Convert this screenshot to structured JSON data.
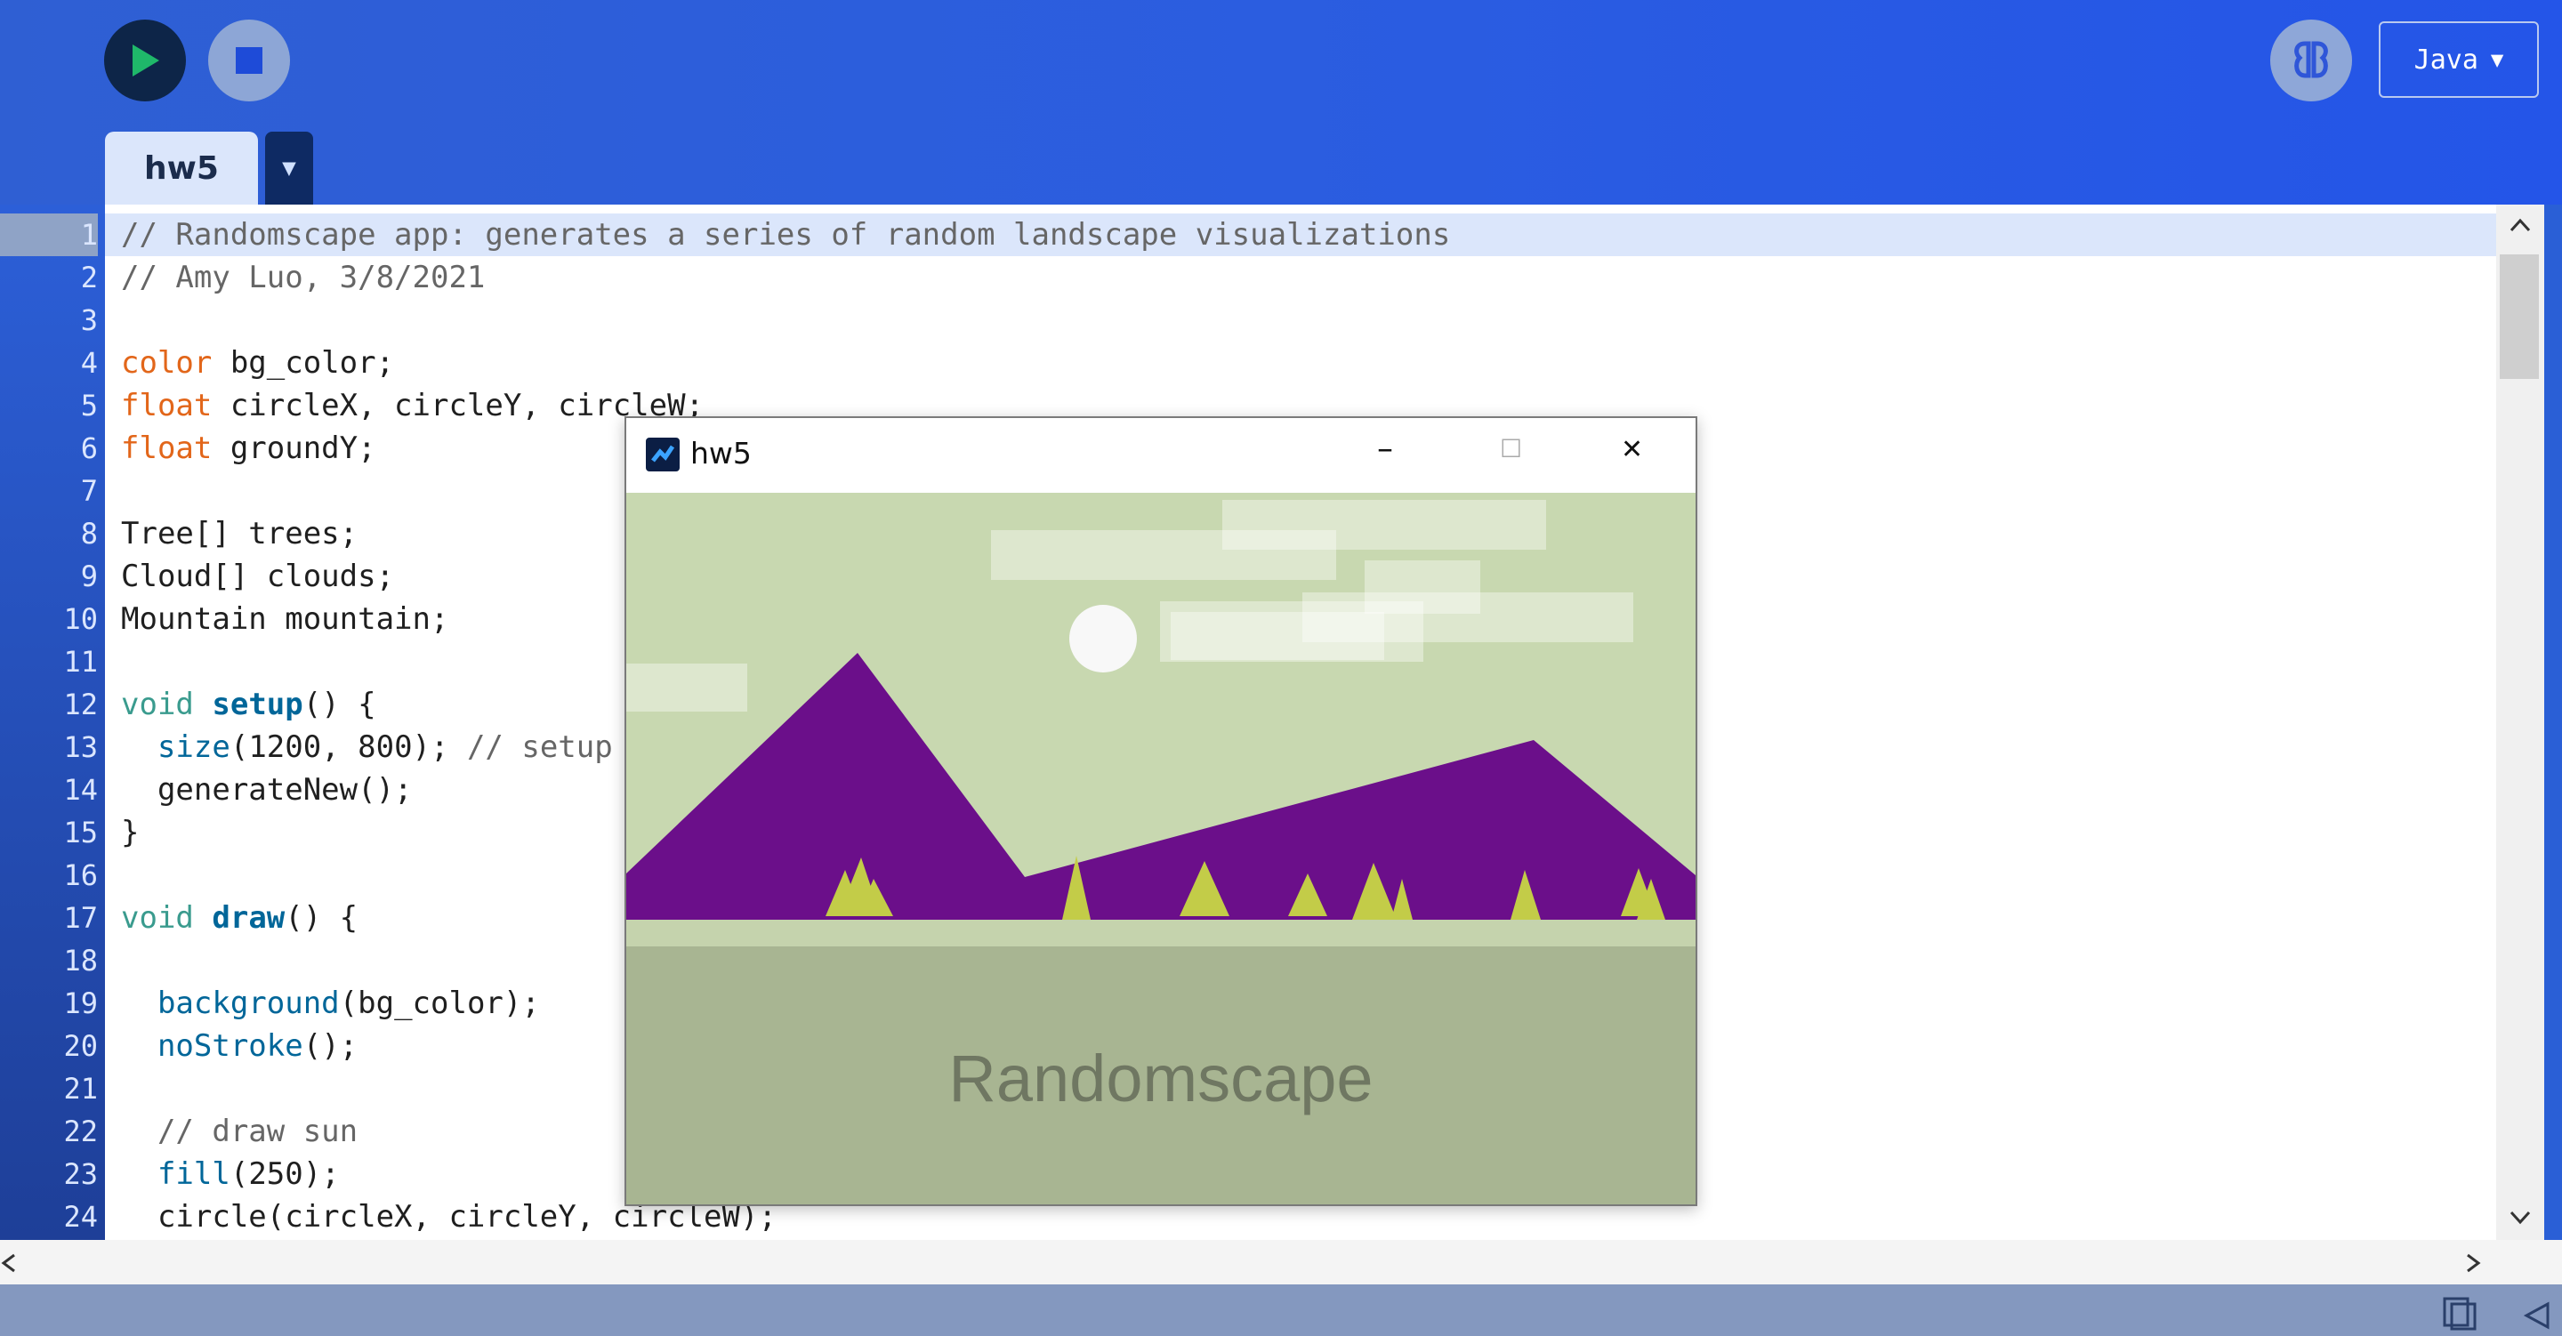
{
  "toolbar": {
    "run_label": "Run",
    "stop_label": "Stop",
    "mode": "Java",
    "mode_arrow": "▼"
  },
  "tabs": [
    {
      "label": "hw5"
    }
  ],
  "tab_menu_arrow": "▼",
  "editor": {
    "active_line": 1,
    "lines": [
      {
        "n": "1",
        "segs": [
          {
            "t": "// Randomscape app: generates a series of random landscape visualizations",
            "c": "comment"
          }
        ]
      },
      {
        "n": "2",
        "segs": [
          {
            "t": "// Amy Luo, 3/8/2021",
            "c": "comment"
          }
        ]
      },
      {
        "n": "3",
        "segs": []
      },
      {
        "n": "4",
        "segs": [
          {
            "t": "color",
            "c": "kw-type"
          },
          {
            "t": " bg_color;",
            "c": ""
          }
        ]
      },
      {
        "n": "5",
        "segs": [
          {
            "t": "float",
            "c": "kw-type"
          },
          {
            "t": " circleX, circleY, circleW;",
            "c": ""
          }
        ]
      },
      {
        "n": "6",
        "segs": [
          {
            "t": "float",
            "c": "kw-type"
          },
          {
            "t": " groundY;",
            "c": ""
          }
        ]
      },
      {
        "n": "7",
        "segs": []
      },
      {
        "n": "8",
        "segs": [
          {
            "t": "Tree[] trees;",
            "c": ""
          }
        ]
      },
      {
        "n": "9",
        "segs": [
          {
            "t": "Cloud[] clouds;",
            "c": ""
          }
        ]
      },
      {
        "n": "10",
        "segs": [
          {
            "t": "Mountain mountain;",
            "c": ""
          }
        ]
      },
      {
        "n": "11",
        "segs": []
      },
      {
        "n": "12",
        "segs": [
          {
            "t": "void",
            "c": "kw-ctrl"
          },
          {
            "t": " ",
            "c": ""
          },
          {
            "t": "setup",
            "c": "fn-def"
          },
          {
            "t": "() {",
            "c": ""
          }
        ]
      },
      {
        "n": "13",
        "segs": [
          {
            "t": "  ",
            "c": ""
          },
          {
            "t": "size",
            "c": "fn-call"
          },
          {
            "t": "(1200, 800); ",
            "c": ""
          },
          {
            "t": "// setup",
            "c": "comment"
          }
        ]
      },
      {
        "n": "14",
        "segs": [
          {
            "t": "  generateNew();",
            "c": ""
          }
        ]
      },
      {
        "n": "15",
        "segs": [
          {
            "t": "}",
            "c": ""
          }
        ]
      },
      {
        "n": "16",
        "segs": []
      },
      {
        "n": "17",
        "segs": [
          {
            "t": "void",
            "c": "kw-ctrl"
          },
          {
            "t": " ",
            "c": ""
          },
          {
            "t": "draw",
            "c": "fn-def"
          },
          {
            "t": "() {",
            "c": ""
          }
        ]
      },
      {
        "n": "18",
        "segs": []
      },
      {
        "n": "19",
        "segs": [
          {
            "t": "  ",
            "c": ""
          },
          {
            "t": "background",
            "c": "fn-call"
          },
          {
            "t": "(bg_color);",
            "c": ""
          }
        ]
      },
      {
        "n": "20",
        "segs": [
          {
            "t": "  ",
            "c": ""
          },
          {
            "t": "noStroke",
            "c": "fn-call"
          },
          {
            "t": "();",
            "c": ""
          }
        ]
      },
      {
        "n": "21",
        "segs": []
      },
      {
        "n": "22",
        "segs": [
          {
            "t": "  ",
            "c": ""
          },
          {
            "t": "// draw sun",
            "c": "comment"
          }
        ]
      },
      {
        "n": "23",
        "segs": [
          {
            "t": "  ",
            "c": ""
          },
          {
            "t": "fill",
            "c": "fn-call"
          },
          {
            "t": "(250);",
            "c": ""
          }
        ]
      },
      {
        "n": "24",
        "segs": [
          {
            "t": "  circle(circleX, circleY, circleW);",
            "c": ""
          }
        ]
      }
    ]
  },
  "sketch_window": {
    "title": "hw5",
    "minimize_glyph": "–",
    "maximize_glyph": "☐",
    "close_glyph": "✕",
    "canvas_text": "Randomscape",
    "colors": {
      "sky": "#c8d8b0",
      "mountain": "#6b0f8a",
      "trees": "#c3cc48",
      "ground_strip": "#c5d3ad",
      "ground": "#a8b592",
      "sun": "#f8f8f8",
      "text": "#6f7762"
    }
  },
  "icons": {
    "run": "play-icon",
    "stop": "stop-icon",
    "debug": "debugger-icon",
    "scroll_up": "chevron-up-icon",
    "scroll_down": "chevron-down-icon",
    "scroll_left": "chevron-left-icon",
    "scroll_right": "chevron-right-icon",
    "console": "console-toggle-icon",
    "collapse": "collapse-left-icon"
  }
}
